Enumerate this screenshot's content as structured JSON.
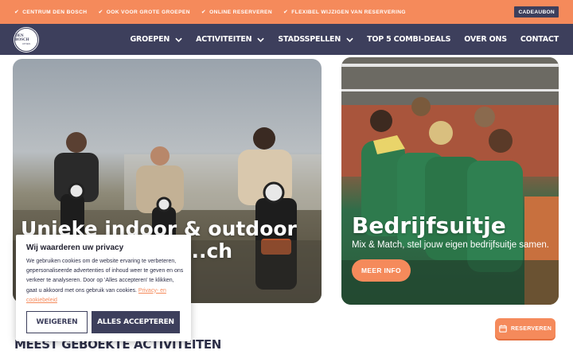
{
  "topbar": {
    "usps": [
      "CENTRUM DEN BOSCH",
      "OOK VOOR GROTE GROEPEN",
      "ONLINE RESERVEREN",
      "FLEXIBEL WIJZIGEN VAN RESERVERING"
    ],
    "gift_label": "CADEAUBON"
  },
  "logo": {
    "line1": "DEN BOSCH",
    "line2": "UITJES"
  },
  "nav": {
    "items": [
      {
        "label": "GROEPEN",
        "has_dropdown": true
      },
      {
        "label": "ACTIVITEITEN",
        "has_dropdown": true
      },
      {
        "label": "STADSSPELLEN",
        "has_dropdown": true
      },
      {
        "label": "TOP 5 COMBI-DEALS",
        "has_dropdown": false
      },
      {
        "label": "OVER ONS",
        "has_dropdown": false
      },
      {
        "label": "CONTACT",
        "has_dropdown": false
      }
    ]
  },
  "hero_left": {
    "title_line1": "Unieke indoor & outdoor",
    "title_line2": "...ch"
  },
  "hero_right": {
    "title": "Bedrijfsuitje",
    "subtitle": "Mix & Match, stel jouw eigen bedrijfsuitje samen.",
    "button_label": "MEER INFO"
  },
  "section": {
    "title": "MEEST GEBOEKTE ACTIVITEITEN"
  },
  "reserve": {
    "label": "RESERVEREN"
  },
  "cookie": {
    "title": "Wij waarderen uw privacy",
    "text": "We gebruiken cookies om de website ervaring te verbeteren, gepersonaliseerde advertenties of inhoud weer te geven en ons verkeer te analyseren. Door op 'Alles accepteren' te klikken, gaat u akkoord met ons gebruik van cookies.",
    "link_label": "Privacy- en cookiebeleid",
    "decline_label": "WEIGEREN",
    "accept_label": "ALLES ACCEPTEREN"
  },
  "colors": {
    "accent": "#f58a5b",
    "navy": "#3d3f5c"
  }
}
